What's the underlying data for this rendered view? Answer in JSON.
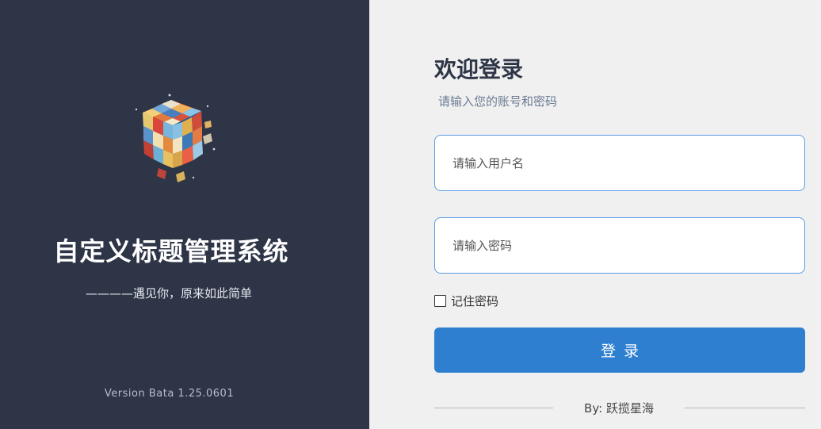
{
  "brand": {
    "title": "自定义标题管理系统",
    "slogan": "————遇见你，原来如此简单",
    "version": "Version Bata 1.25.0601",
    "logo_icon": "rubiks-cube-icon"
  },
  "login": {
    "welcome": "欢迎登录",
    "subtitle": "请输入您的账号和密码",
    "username_placeholder": "请输入用户名",
    "username_value": "",
    "password_placeholder": "请输入密码",
    "password_value": "",
    "remember_label": "记住密码",
    "remember_checked": false,
    "submit_label": "登录",
    "author": "By: 跃揽星海"
  },
  "colors": {
    "left_panel_bg": "#2e3547",
    "right_panel_bg": "#f0f0f0",
    "accent": "#2f7fd0",
    "field_border": "#5b9be6"
  }
}
